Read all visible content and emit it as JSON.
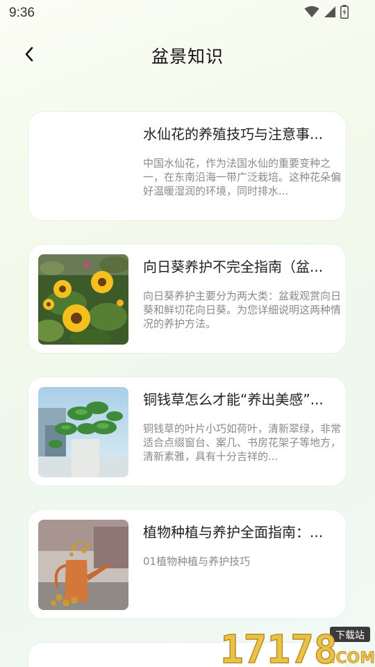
{
  "status_bar": {
    "time": "9:36",
    "icons": [
      "wifi-icon",
      "signal-icon",
      "battery-charging-icon"
    ]
  },
  "header": {
    "title": "盆景知识",
    "back_icon": "chevron-left-icon"
  },
  "articles": [
    {
      "title": "水仙花的养殖技巧与注意事...",
      "description": "中国水仙花，作为法国水仙的重要变种之一，在东南沿海一带广泛栽培。这种花朵偏好温暖湿润的环境，同时排水...",
      "image": "blank"
    },
    {
      "title": "向日葵养护不完全指南（盆...",
      "description": "向日葵养护主要分为两大类：盆栽观赏向日葵和鲜切花向日葵。为您详细说明这两种情况的养护方法。",
      "image": "sunflower-photo"
    },
    {
      "title": "铜钱草怎么才能“养出美感”...",
      "description": "铜钱草的叶片小巧如荷叶，清新翠绿，非常适合点缀窗台、案几、书房花架子等地方，清新素雅，具有十分吉祥的...",
      "image": "pennywort-photo"
    },
    {
      "title": "植物种植与养护全面指南：...",
      "description": "01植物种植与养护技巧",
      "image": "watering-can-photo"
    }
  ],
  "watermark": {
    "number": "17178",
    "badge": "下载站",
    "suffix": ".COM"
  },
  "colors": {
    "card_border": "#e6f2e8",
    "title": "#222222",
    "description": "#8a8a8a",
    "watermark": "#e8c34a"
  }
}
